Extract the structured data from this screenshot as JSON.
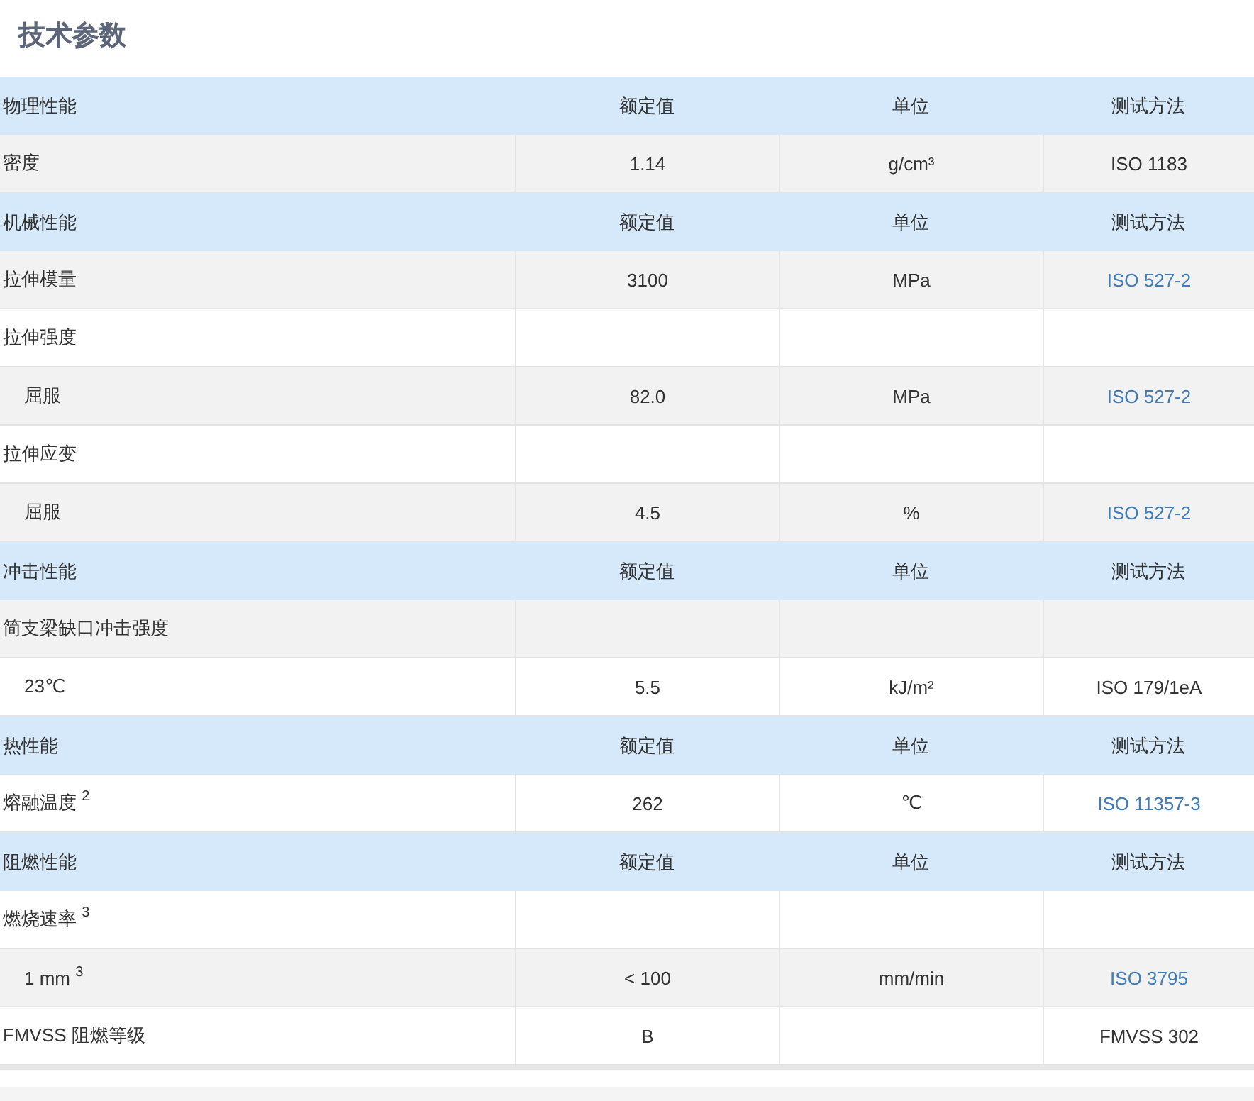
{
  "title": "技术参数",
  "sections": [
    {
      "header": [
        "物理性能",
        "额定值",
        "单位",
        "测试方法"
      ],
      "rows": [
        {
          "shaded": true,
          "cells": [
            "密度",
            "1.14",
            "g/cm³"
          ],
          "method": {
            "text": "ISO 1183",
            "link": false
          }
        }
      ]
    },
    {
      "header": [
        "机械性能",
        "额定值",
        "单位",
        "测试方法"
      ],
      "rows": [
        {
          "shaded": true,
          "cells": [
            "拉伸模量",
            "3100",
            "MPa"
          ],
          "method": {
            "text": "ISO 527-2",
            "link": true
          }
        },
        {
          "shaded": false,
          "cells": [
            "拉伸强度"
          ],
          "children": [
            {
              "shaded": true,
              "cells": [
                "屈服",
                "82.0",
                "MPa"
              ],
              "method": {
                "text": "ISO 527-2",
                "link": true
              }
            }
          ]
        },
        {
          "shaded": false,
          "cells": [
            "拉伸应变"
          ],
          "children": [
            {
              "shaded": true,
              "cells": [
                "屈服",
                "4.5",
                "%"
              ],
              "method": {
                "text": "ISO 527-2",
                "link": true
              }
            }
          ]
        }
      ]
    },
    {
      "header": [
        "冲击性能",
        "额定值",
        "单位",
        "测试方法"
      ],
      "rows": [
        {
          "shaded": true,
          "cells": [
            "简支梁缺口冲击强度"
          ],
          "children": [
            {
              "shaded": false,
              "cells": [
                "23℃",
                "5.5",
                "kJ/m²"
              ],
              "method": {
                "text": "ISO 179/1eA",
                "link": false
              }
            }
          ]
        }
      ]
    },
    {
      "header": [
        "热性能",
        "额定值",
        "单位",
        "测试方法"
      ],
      "rows": [
        {
          "shaded": false,
          "cells": [
            "熔融温度 $^{2}$",
            "262",
            "℃"
          ],
          "method": {
            "text": "ISO 11357-3",
            "link": true
          }
        }
      ]
    },
    {
      "header": [
        "阻燃性能",
        "额定值",
        "单位",
        "测试方法"
      ],
      "rows": [
        {
          "shaded": false,
          "cells": [
            "燃烧速率 $^{3}$"
          ],
          "children": [
            {
              "shaded": true,
              "cells": [
                "1 mm $^{3}$",
                "< 100",
                "mm/min"
              ],
              "method": {
                "text": "ISO 3795",
                "link": true
              }
            }
          ]
        },
        {
          "shaded": false,
          "cells": [
            "FMVSS 阻燃等级",
            "B"
          ],
          "method": {
            "text": "FMVSS 302",
            "link": false
          }
        }
      ]
    }
  ]
}
